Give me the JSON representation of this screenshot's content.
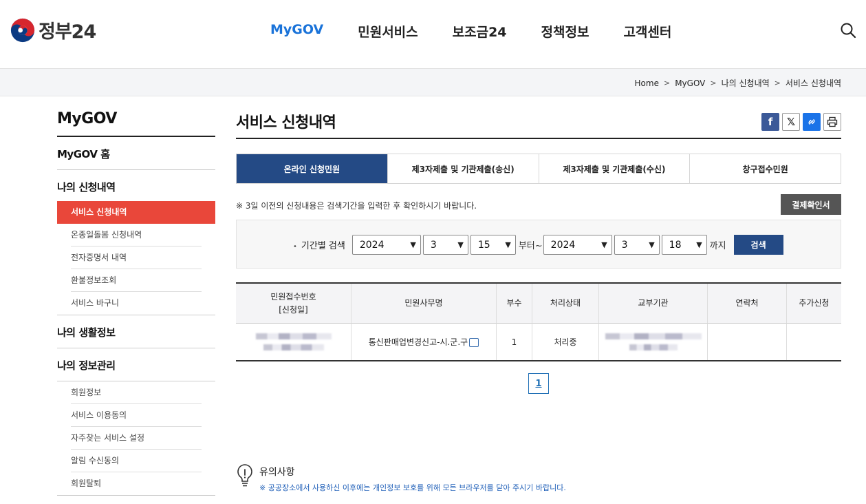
{
  "header": {
    "logo_text": "정부24",
    "nav": [
      "MyGOV",
      "민원서비스",
      "보조금24",
      "정책정보",
      "고객센터"
    ],
    "active_nav": "MyGOV",
    "search_icon": "search-icon"
  },
  "breadcrumb": [
    "Home",
    "MyGOV",
    "나의 신청내역",
    "서비스 신청내역"
  ],
  "sidebar": {
    "title": "MyGOV",
    "home": "MyGOV 홈",
    "group1": "나의 신청내역",
    "group1_items": [
      "서비스 신청내역",
      "온종일돌봄 신청내역",
      "전자증명서 내역",
      "환불정보조회",
      "서비스 바구니"
    ],
    "group2": "나의 생활정보",
    "group3": "나의 정보관리",
    "group3_items": [
      "회원정보",
      "서비스 이용동의",
      "자주찾는 서비스 설정",
      "알림 수신동의",
      "회원탈퇴"
    ]
  },
  "main": {
    "title": "서비스 신청내역",
    "tabs": [
      "온라인 신청민원",
      "제3자제출 및 기관제출(송신)",
      "제3자제출 및 기관제출(수신)",
      "창구접수민원"
    ],
    "notice": "※ 3일 이전의 신청내용은 검색기간을 입력한 후 확인하시기 바랍니다.",
    "confirm_button": "결제확인서",
    "search": {
      "label": "기간별 검색",
      "from_year": "2024",
      "from_month": "3",
      "from_day": "15",
      "from_suffix": "부터~",
      "to_year": "2024",
      "to_month": "3",
      "to_day": "18",
      "to_suffix": "까지",
      "button": "검색"
    },
    "table": {
      "headers": [
        "민원접수번호\n[신청일]",
        "민원사무명",
        "부수",
        "처리상태",
        "교부기관",
        "연락처",
        "추가신청"
      ],
      "rows": [
        {
          "receipt": "",
          "service": "통신판매업변경신고-시.군.구",
          "copies": "1",
          "status": "처리중",
          "agency": "",
          "contact": "",
          "extra": ""
        }
      ]
    },
    "pagination": [
      "1"
    ],
    "caution": {
      "title": "유의사항",
      "text": "※ 공공장소에서 사용하신 이후에는 개인정보 보호를 위해 모든 브라우저를 닫아 주시기 바랍니다."
    }
  }
}
